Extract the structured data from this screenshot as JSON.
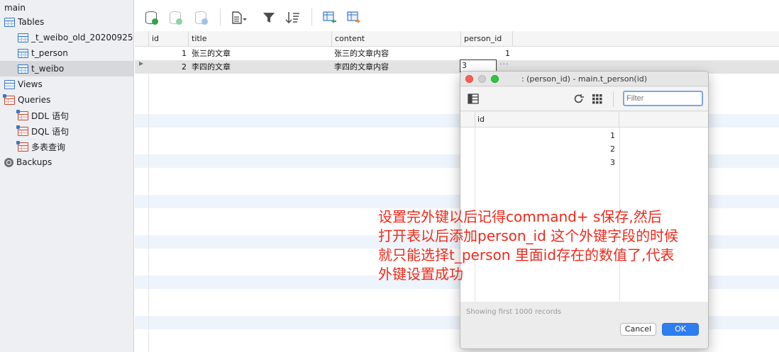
{
  "sidebar": {
    "root": "main",
    "items": [
      {
        "label": "Tables",
        "icon": "tables-icon"
      },
      {
        "label": "_t_weibo_old_20200925",
        "icon": "table-icon"
      },
      {
        "label": "t_person",
        "icon": "table-icon"
      },
      {
        "label": "t_weibo",
        "icon": "table-icon",
        "selected": true
      },
      {
        "label": "Views",
        "icon": "views-icon"
      },
      {
        "label": "Queries",
        "icon": "queries-icon"
      },
      {
        "label": "DDL 语句",
        "icon": "query-icon"
      },
      {
        "label": "DQL 语句",
        "icon": "query-icon"
      },
      {
        "label": "多表查询",
        "icon": "query-icon"
      },
      {
        "label": "Backups",
        "icon": "backups-icon"
      }
    ]
  },
  "toolbar": {
    "buttons": [
      "add-row-icon",
      "commit-icon",
      "discard-icon",
      "document-icon",
      "filter-icon",
      "sort-icon",
      "import-icon",
      "export-icon"
    ]
  },
  "grid": {
    "columns": [
      "id",
      "title",
      "content",
      "person_id"
    ],
    "rows": [
      {
        "id": "1",
        "title": "张三的文章",
        "content": "张三的文章内容",
        "person_id": "1"
      },
      {
        "id": "2",
        "title": "李四的文章",
        "content": "李四的文章内容",
        "person_id": "3"
      }
    ],
    "editing_value": "3",
    "ellipsis": "···"
  },
  "popup": {
    "title": ": (person_id) - main.t_person(id)",
    "filter_placeholder": "Filter",
    "column": "id",
    "rows": [
      "1",
      "2",
      "3"
    ],
    "status": "Showing first 1000 records",
    "cancel_label": "Cancel",
    "ok_label": "OK"
  },
  "annotation": {
    "lines": [
      "设置完外键以后记得command+ s保存,然后",
      "打开表以后添加person_id 这个外键字段的时候",
      "就只能选择t_person 里面id存在的数值了,代表",
      "外键设置成功"
    ]
  },
  "colors": {
    "accent": "#2f7ef0",
    "annotation": "#ee2a1c",
    "traffic_close": "#fc5f57",
    "traffic_min": "#cfcfcf",
    "traffic_max": "#29c840"
  }
}
